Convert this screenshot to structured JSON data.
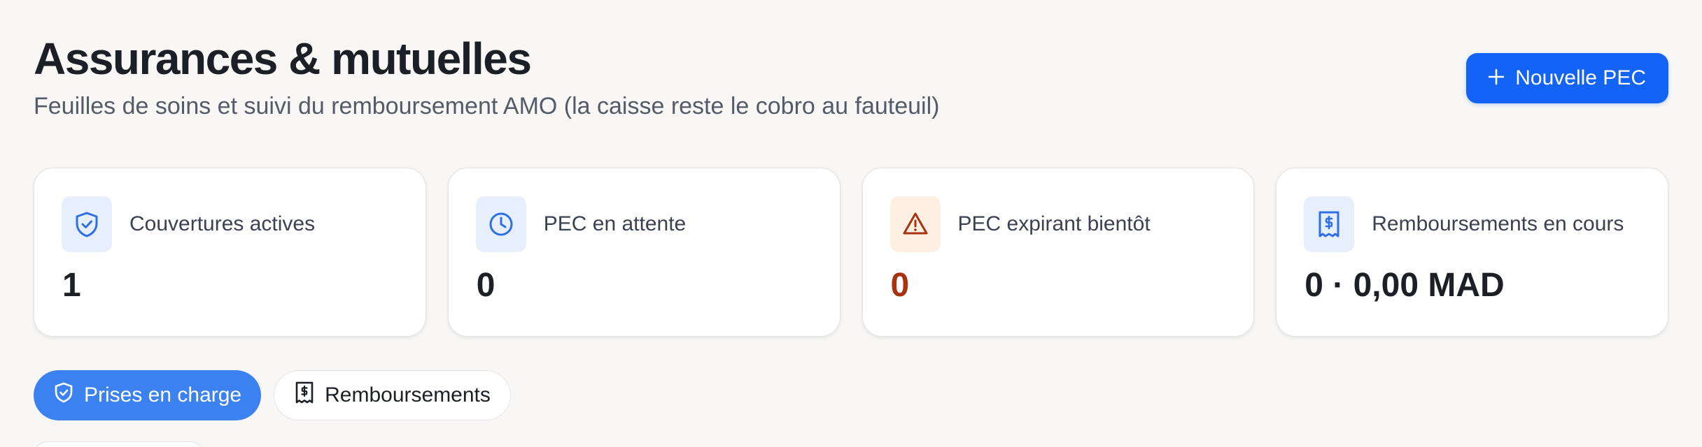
{
  "header": {
    "title": "Assurances & mutuelles",
    "subtitle": "Feuilles de soins et suivi du remboursement AMO (la caisse reste le cobro au fauteuil)",
    "new_button_label": "Nouvelle PEC",
    "new_button_icon": "plus-icon"
  },
  "cards": [
    {
      "icon": "shield-check-icon",
      "label": "Couvertures actives",
      "value": "1",
      "value_color": "#1c1f26",
      "icon_color": "#2f6fe4"
    },
    {
      "icon": "clock-icon",
      "label": "PEC en attente",
      "value": "0",
      "value_color": "#1c1f26",
      "icon_color": "#2f6fe4"
    },
    {
      "icon": "warning-triangle-icon",
      "label": "PEC expirant bientôt",
      "value": "0",
      "value_color": "#a8320f",
      "icon_color": "#a8320f"
    },
    {
      "icon": "receipt-dollar-icon",
      "label": "Remboursements en cours",
      "value": "0 · 0,00 MAD",
      "value_color": "#1c1f26",
      "icon_color": "#2f6fe4"
    }
  ],
  "tabs": [
    {
      "label": "Prises en charge",
      "icon": "shield-check-icon",
      "active": true
    },
    {
      "label": "Remboursements",
      "icon": "receipt-dollar-icon",
      "active": false
    }
  ],
  "colors": {
    "accent": "#1463f7",
    "active_tab": "#3b82f0",
    "warning": "#a8320f"
  }
}
